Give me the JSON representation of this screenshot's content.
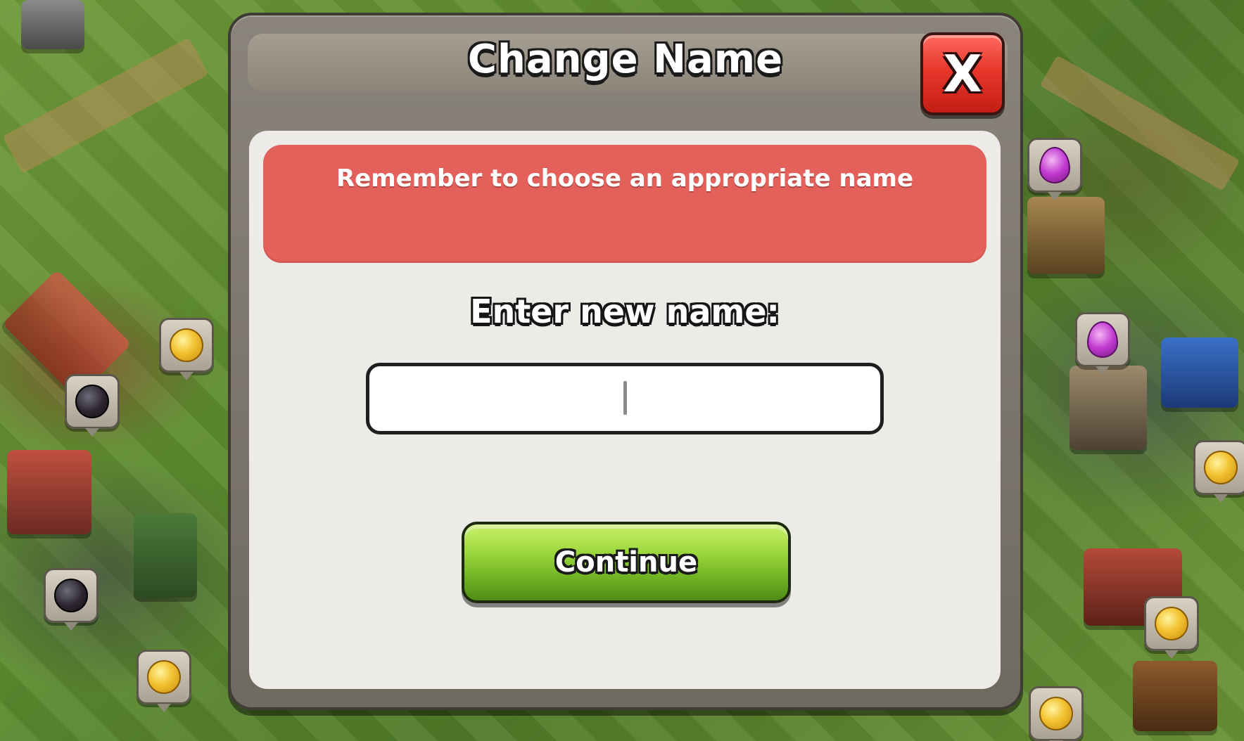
{
  "dialog": {
    "title": "Change Name",
    "close_label": "X",
    "warning": "Remember to choose an appropriate name",
    "prompt": "Enter new name:",
    "input_value": "",
    "continue_label": "Continue"
  },
  "background": {
    "markers": [
      {
        "type": "gold-coin-icon"
      },
      {
        "type": "dark-elixir-icon"
      },
      {
        "type": "dark-elixir-icon"
      },
      {
        "type": "gold-coin-icon"
      },
      {
        "type": "elixir-drop-icon"
      },
      {
        "type": "elixir-drop-icon"
      },
      {
        "type": "gold-coin-icon"
      },
      {
        "type": "gold-coin-icon"
      },
      {
        "type": "gold-coin-icon"
      }
    ]
  },
  "colors": {
    "warning": "#e4605a",
    "close_button": "#e8372b",
    "continue_button": "#8fcc35",
    "modal_frame": "#7d776d",
    "modal_body": "#ecebe7"
  }
}
